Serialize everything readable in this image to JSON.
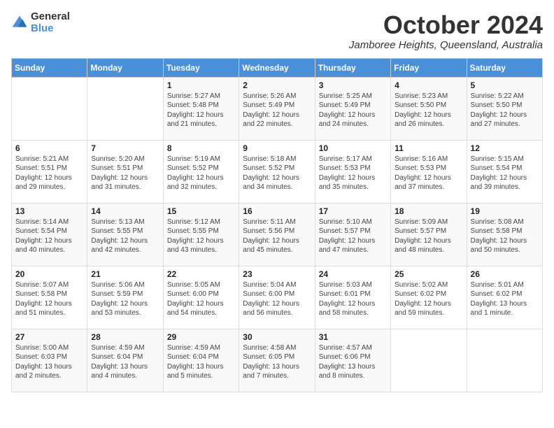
{
  "logo": {
    "general": "General",
    "blue": "Blue"
  },
  "header": {
    "month": "October 2024",
    "location": "Jamboree Heights, Queensland, Australia"
  },
  "days_of_week": [
    "Sunday",
    "Monday",
    "Tuesday",
    "Wednesday",
    "Thursday",
    "Friday",
    "Saturday"
  ],
  "weeks": [
    [
      {
        "day": "",
        "text": ""
      },
      {
        "day": "",
        "text": ""
      },
      {
        "day": "1",
        "text": "Sunrise: 5:27 AM\nSunset: 5:48 PM\nDaylight: 12 hours and 21 minutes."
      },
      {
        "day": "2",
        "text": "Sunrise: 5:26 AM\nSunset: 5:49 PM\nDaylight: 12 hours and 22 minutes."
      },
      {
        "day": "3",
        "text": "Sunrise: 5:25 AM\nSunset: 5:49 PM\nDaylight: 12 hours and 24 minutes."
      },
      {
        "day": "4",
        "text": "Sunrise: 5:23 AM\nSunset: 5:50 PM\nDaylight: 12 hours and 26 minutes."
      },
      {
        "day": "5",
        "text": "Sunrise: 5:22 AM\nSunset: 5:50 PM\nDaylight: 12 hours and 27 minutes."
      }
    ],
    [
      {
        "day": "6",
        "text": "Sunrise: 5:21 AM\nSunset: 5:51 PM\nDaylight: 12 hours and 29 minutes."
      },
      {
        "day": "7",
        "text": "Sunrise: 5:20 AM\nSunset: 5:51 PM\nDaylight: 12 hours and 31 minutes."
      },
      {
        "day": "8",
        "text": "Sunrise: 5:19 AM\nSunset: 5:52 PM\nDaylight: 12 hours and 32 minutes."
      },
      {
        "day": "9",
        "text": "Sunrise: 5:18 AM\nSunset: 5:52 PM\nDaylight: 12 hours and 34 minutes."
      },
      {
        "day": "10",
        "text": "Sunrise: 5:17 AM\nSunset: 5:53 PM\nDaylight: 12 hours and 35 minutes."
      },
      {
        "day": "11",
        "text": "Sunrise: 5:16 AM\nSunset: 5:53 PM\nDaylight: 12 hours and 37 minutes."
      },
      {
        "day": "12",
        "text": "Sunrise: 5:15 AM\nSunset: 5:54 PM\nDaylight: 12 hours and 39 minutes."
      }
    ],
    [
      {
        "day": "13",
        "text": "Sunrise: 5:14 AM\nSunset: 5:54 PM\nDaylight: 12 hours and 40 minutes."
      },
      {
        "day": "14",
        "text": "Sunrise: 5:13 AM\nSunset: 5:55 PM\nDaylight: 12 hours and 42 minutes."
      },
      {
        "day": "15",
        "text": "Sunrise: 5:12 AM\nSunset: 5:55 PM\nDaylight: 12 hours and 43 minutes."
      },
      {
        "day": "16",
        "text": "Sunrise: 5:11 AM\nSunset: 5:56 PM\nDaylight: 12 hours and 45 minutes."
      },
      {
        "day": "17",
        "text": "Sunrise: 5:10 AM\nSunset: 5:57 PM\nDaylight: 12 hours and 47 minutes."
      },
      {
        "day": "18",
        "text": "Sunrise: 5:09 AM\nSunset: 5:57 PM\nDaylight: 12 hours and 48 minutes."
      },
      {
        "day": "19",
        "text": "Sunrise: 5:08 AM\nSunset: 5:58 PM\nDaylight: 12 hours and 50 minutes."
      }
    ],
    [
      {
        "day": "20",
        "text": "Sunrise: 5:07 AM\nSunset: 5:58 PM\nDaylight: 12 hours and 51 minutes."
      },
      {
        "day": "21",
        "text": "Sunrise: 5:06 AM\nSunset: 5:59 PM\nDaylight: 12 hours and 53 minutes."
      },
      {
        "day": "22",
        "text": "Sunrise: 5:05 AM\nSunset: 6:00 PM\nDaylight: 12 hours and 54 minutes."
      },
      {
        "day": "23",
        "text": "Sunrise: 5:04 AM\nSunset: 6:00 PM\nDaylight: 12 hours and 56 minutes."
      },
      {
        "day": "24",
        "text": "Sunrise: 5:03 AM\nSunset: 6:01 PM\nDaylight: 12 hours and 58 minutes."
      },
      {
        "day": "25",
        "text": "Sunrise: 5:02 AM\nSunset: 6:02 PM\nDaylight: 12 hours and 59 minutes."
      },
      {
        "day": "26",
        "text": "Sunrise: 5:01 AM\nSunset: 6:02 PM\nDaylight: 13 hours and 1 minute."
      }
    ],
    [
      {
        "day": "27",
        "text": "Sunrise: 5:00 AM\nSunset: 6:03 PM\nDaylight: 13 hours and 2 minutes."
      },
      {
        "day": "28",
        "text": "Sunrise: 4:59 AM\nSunset: 6:04 PM\nDaylight: 13 hours and 4 minutes."
      },
      {
        "day": "29",
        "text": "Sunrise: 4:59 AM\nSunset: 6:04 PM\nDaylight: 13 hours and 5 minutes."
      },
      {
        "day": "30",
        "text": "Sunrise: 4:58 AM\nSunset: 6:05 PM\nDaylight: 13 hours and 7 minutes."
      },
      {
        "day": "31",
        "text": "Sunrise: 4:57 AM\nSunset: 6:06 PM\nDaylight: 13 hours and 8 minutes."
      },
      {
        "day": "",
        "text": ""
      },
      {
        "day": "",
        "text": ""
      }
    ]
  ]
}
